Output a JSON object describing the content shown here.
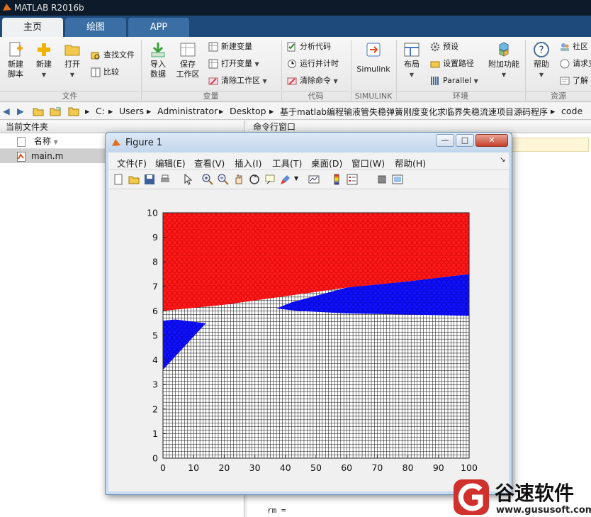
{
  "app": {
    "title": "MATLAB R2016b"
  },
  "tabs": [
    {
      "label": "主页"
    },
    {
      "label": "绘图"
    },
    {
      "label": "APP"
    }
  ],
  "ribbon": {
    "file": {
      "new_script": "新建\n脚本",
      "new": "新建",
      "open": "打开",
      "find_files": "查找文件",
      "compare": "比较",
      "section": "文件"
    },
    "variable": {
      "import": "导入\n数据",
      "save_ws": "保存\n工作区",
      "new_var": "新建变量",
      "open_var": "打开变量",
      "clear_ws": "清除工作区",
      "section": "变量"
    },
    "code": {
      "analyze": "分析代码",
      "run_time": "运行并计时",
      "clear_cmd": "清除命令",
      "section": "代码"
    },
    "simulink": {
      "label": "Simulink",
      "section": "SIMULINK"
    },
    "env": {
      "layout": "布局",
      "prefs": "预设",
      "set_path": "设置路径",
      "parallel": "Parallel",
      "addons": "附加功能",
      "section": "环境"
    },
    "resources": {
      "help": "帮助",
      "community": "社区",
      "request": "请求支",
      "learn": "了解",
      "section": "资源"
    }
  },
  "address": {
    "parts": [
      "C:",
      "Users",
      "Administrator",
      "Desktop",
      "基于matlab编程输液管失稳弹簧刚度变化求临界失稳流速项目源码程序",
      "code"
    ]
  },
  "current_folder": {
    "title": "当前文件夹",
    "col_name": "名称",
    "file": "main.m"
  },
  "command_window": {
    "title": "命令行窗口",
    "line": "rm ="
  },
  "figure": {
    "title": "Figure 1",
    "menu": [
      "文件(F)",
      "编辑(E)",
      "查看(V)",
      "插入(I)",
      "工具(T)",
      "桌面(D)",
      "窗口(W)",
      "帮助(H)"
    ]
  },
  "chart_data": {
    "type": "scatter",
    "title": "",
    "xlabel": "",
    "ylabel": "",
    "xlim": [
      0,
      100
    ],
    "ylim": [
      0,
      10
    ],
    "xticks": [
      "0",
      "10",
      "20",
      "30",
      "40",
      "50",
      "60",
      "70",
      "80",
      "90",
      "100"
    ],
    "yticks": [
      "0",
      "1",
      "2",
      "3",
      "4",
      "5",
      "6",
      "7",
      "8",
      "9",
      "10"
    ],
    "series": [
      {
        "color": "#ff0000",
        "marker": "circle",
        "region": "upper, above boundary from (0,6) to (100,7.5)",
        "boundary_x": [
          0,
          20,
          40,
          60,
          80,
          100
        ],
        "boundary_y": [
          6.0,
          6.25,
          6.6,
          6.95,
          7.2,
          7.5
        ]
      },
      {
        "color": "#0000ff",
        "marker": "circle",
        "region": "left wedge",
        "points": [
          [
            0,
            3.6
          ],
          [
            0,
            5.6
          ],
          [
            14,
            5.5
          ]
        ]
      },
      {
        "color": "#0000ff",
        "marker": "circle",
        "region": "right band",
        "points": [
          [
            37,
            6.1
          ],
          [
            100,
            5.8
          ],
          [
            100,
            7.5
          ]
        ]
      },
      {
        "color": "#000000",
        "marker": "plus",
        "region": "remainder of grid"
      }
    ]
  },
  "watermark": {
    "text": "谷速软件",
    "url": "www.gususoft.com"
  }
}
